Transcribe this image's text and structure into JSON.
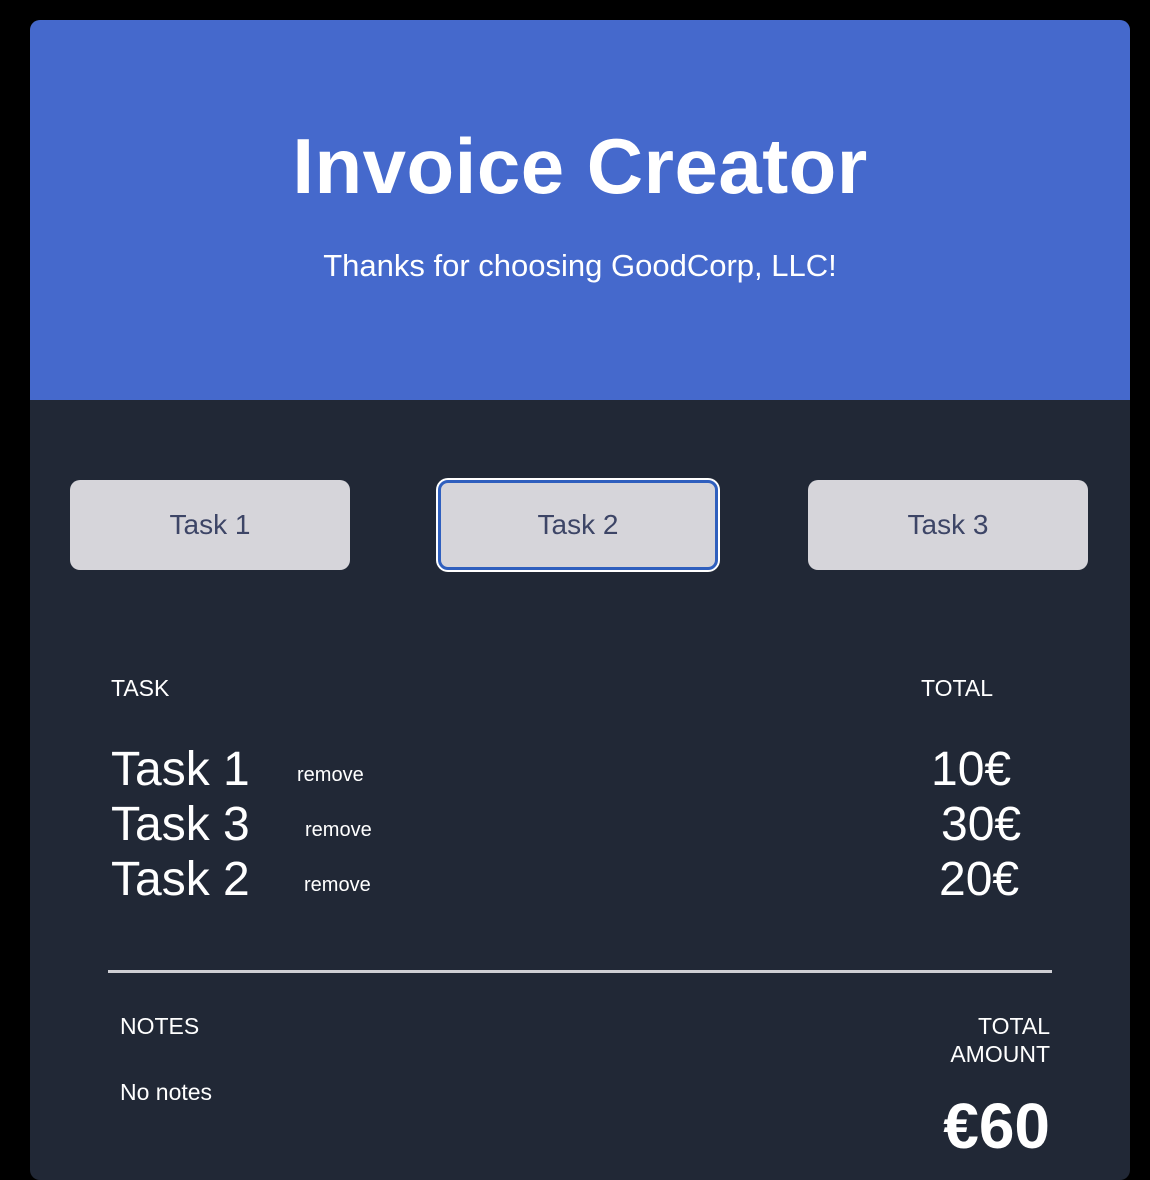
{
  "header": {
    "title": "Invoice Creator",
    "subtitle": "Thanks for choosing GoodCorp, LLC!"
  },
  "task_buttons": [
    {
      "label": "Task 1"
    },
    {
      "label": "Task 2",
      "state": "focused"
    },
    {
      "label": "Task 3"
    }
  ],
  "table": {
    "headers": {
      "task": "TASK",
      "total": "TOTAL"
    },
    "rows": [
      {
        "task": "Task 1",
        "action": "remove",
        "amount": "10€"
      },
      {
        "task": "Task 3",
        "action": "remove",
        "amount": "30€"
      },
      {
        "task": "Task 2",
        "action": "remove",
        "amount": "20€"
      }
    ]
  },
  "footer": {
    "notes_label": "NOTES",
    "notes_value": "No notes",
    "total_label": "TOTAL AMOUNT",
    "total_value": "€60"
  },
  "colors": {
    "header_background": "#4569cc",
    "page_background": "#212836",
    "button_background": "#d6d5da",
    "button_text": "#3d4566",
    "focus_border": "#2f5fbe",
    "text": "#ffffff"
  }
}
